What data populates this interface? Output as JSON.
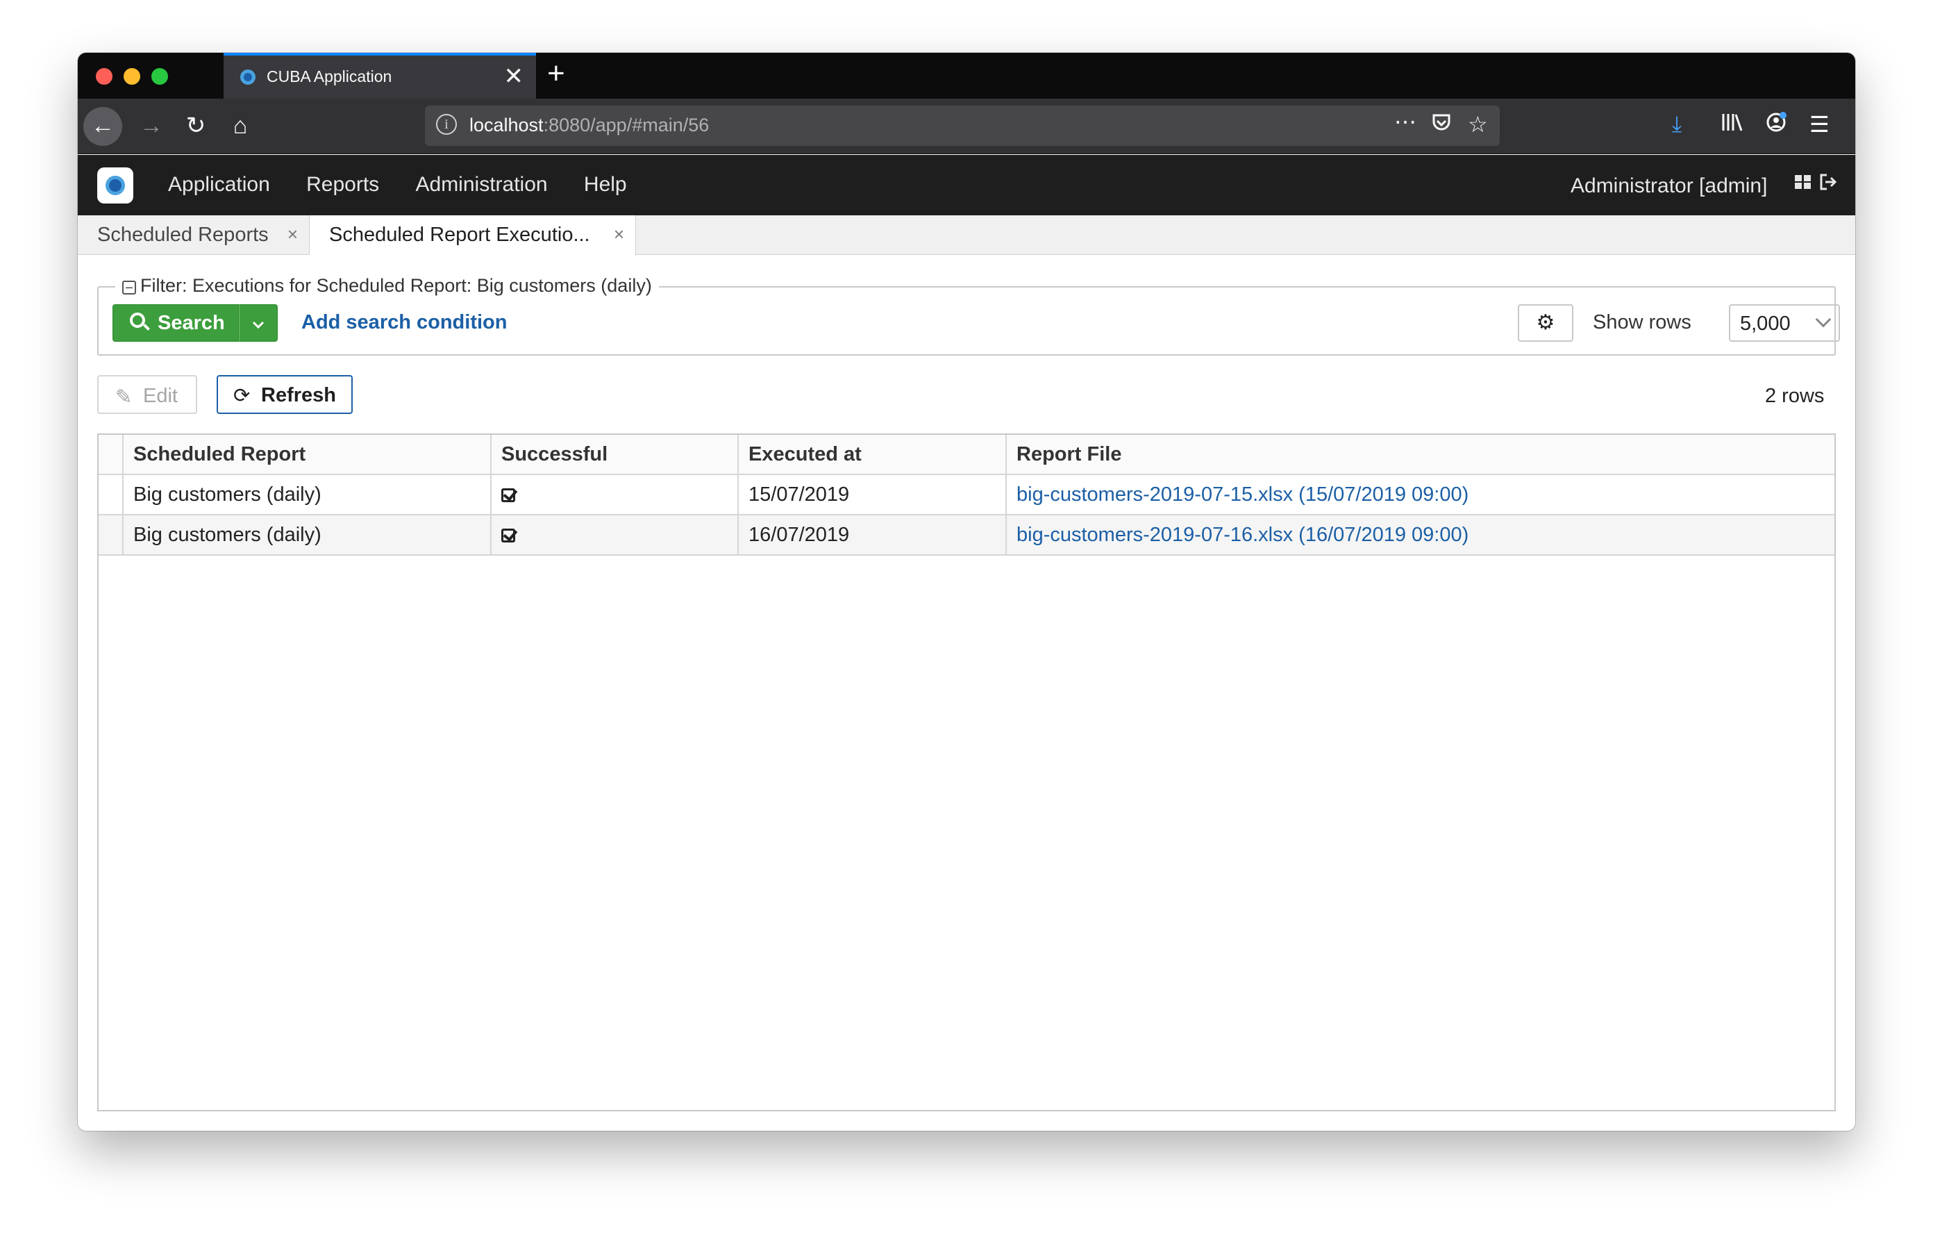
{
  "browser": {
    "tab_title": "CUBA Application",
    "tab_close": "✕",
    "new_tab": "+",
    "url_host": "localhost",
    "url_rest": ":8080/app/#main/56"
  },
  "app": {
    "menu": [
      "Application",
      "Reports",
      "Administration",
      "Help"
    ],
    "user": "Administrator [admin]",
    "tabs": [
      {
        "label": "Scheduled Reports",
        "close": "×"
      },
      {
        "label": "Scheduled Report Executio...",
        "close": "×"
      }
    ]
  },
  "filter": {
    "legend": "Filter: Executions for Scheduled Report: Big customers (daily)",
    "search_label": "Search",
    "add_condition": "Add search condition",
    "show_rows_label": "Show rows",
    "rows_value": "5,000"
  },
  "actions": {
    "edit_label": "Edit",
    "refresh_label": "Refresh",
    "row_count": "2 rows"
  },
  "table": {
    "headers": [
      "Scheduled Report",
      "Successful",
      "Executed at",
      "Report File"
    ],
    "rows": [
      {
        "report": "Big customers (daily)",
        "successful": true,
        "executed_at": "15/07/2019",
        "file": "big-customers-2019-07-15.xlsx (15/07/2019 09:00)"
      },
      {
        "report": "Big customers (daily)",
        "successful": true,
        "executed_at": "16/07/2019",
        "file": "big-customers-2019-07-16.xlsx (16/07/2019 09:00)"
      }
    ]
  },
  "colors": {
    "accent_link": "#1b5fa6",
    "search_green": "#3c9e3c",
    "header_dark": "#1e1e1e",
    "browser_tab_accent": "#0a84ff"
  },
  "icons": [
    "back-arrow-icon",
    "forward-arrow-icon",
    "reload-icon",
    "home-icon",
    "info-icon",
    "more-icon",
    "pocket-icon",
    "bookmark-star-icon",
    "download-icon",
    "library-icon",
    "account-icon",
    "hamburger-menu-icon",
    "cuba-logo-icon",
    "grid-icon",
    "logout-icon",
    "search-icon",
    "chevron-down-icon",
    "gear-icon",
    "pencil-icon",
    "refresh-icon",
    "checkbox-checked-icon"
  ]
}
